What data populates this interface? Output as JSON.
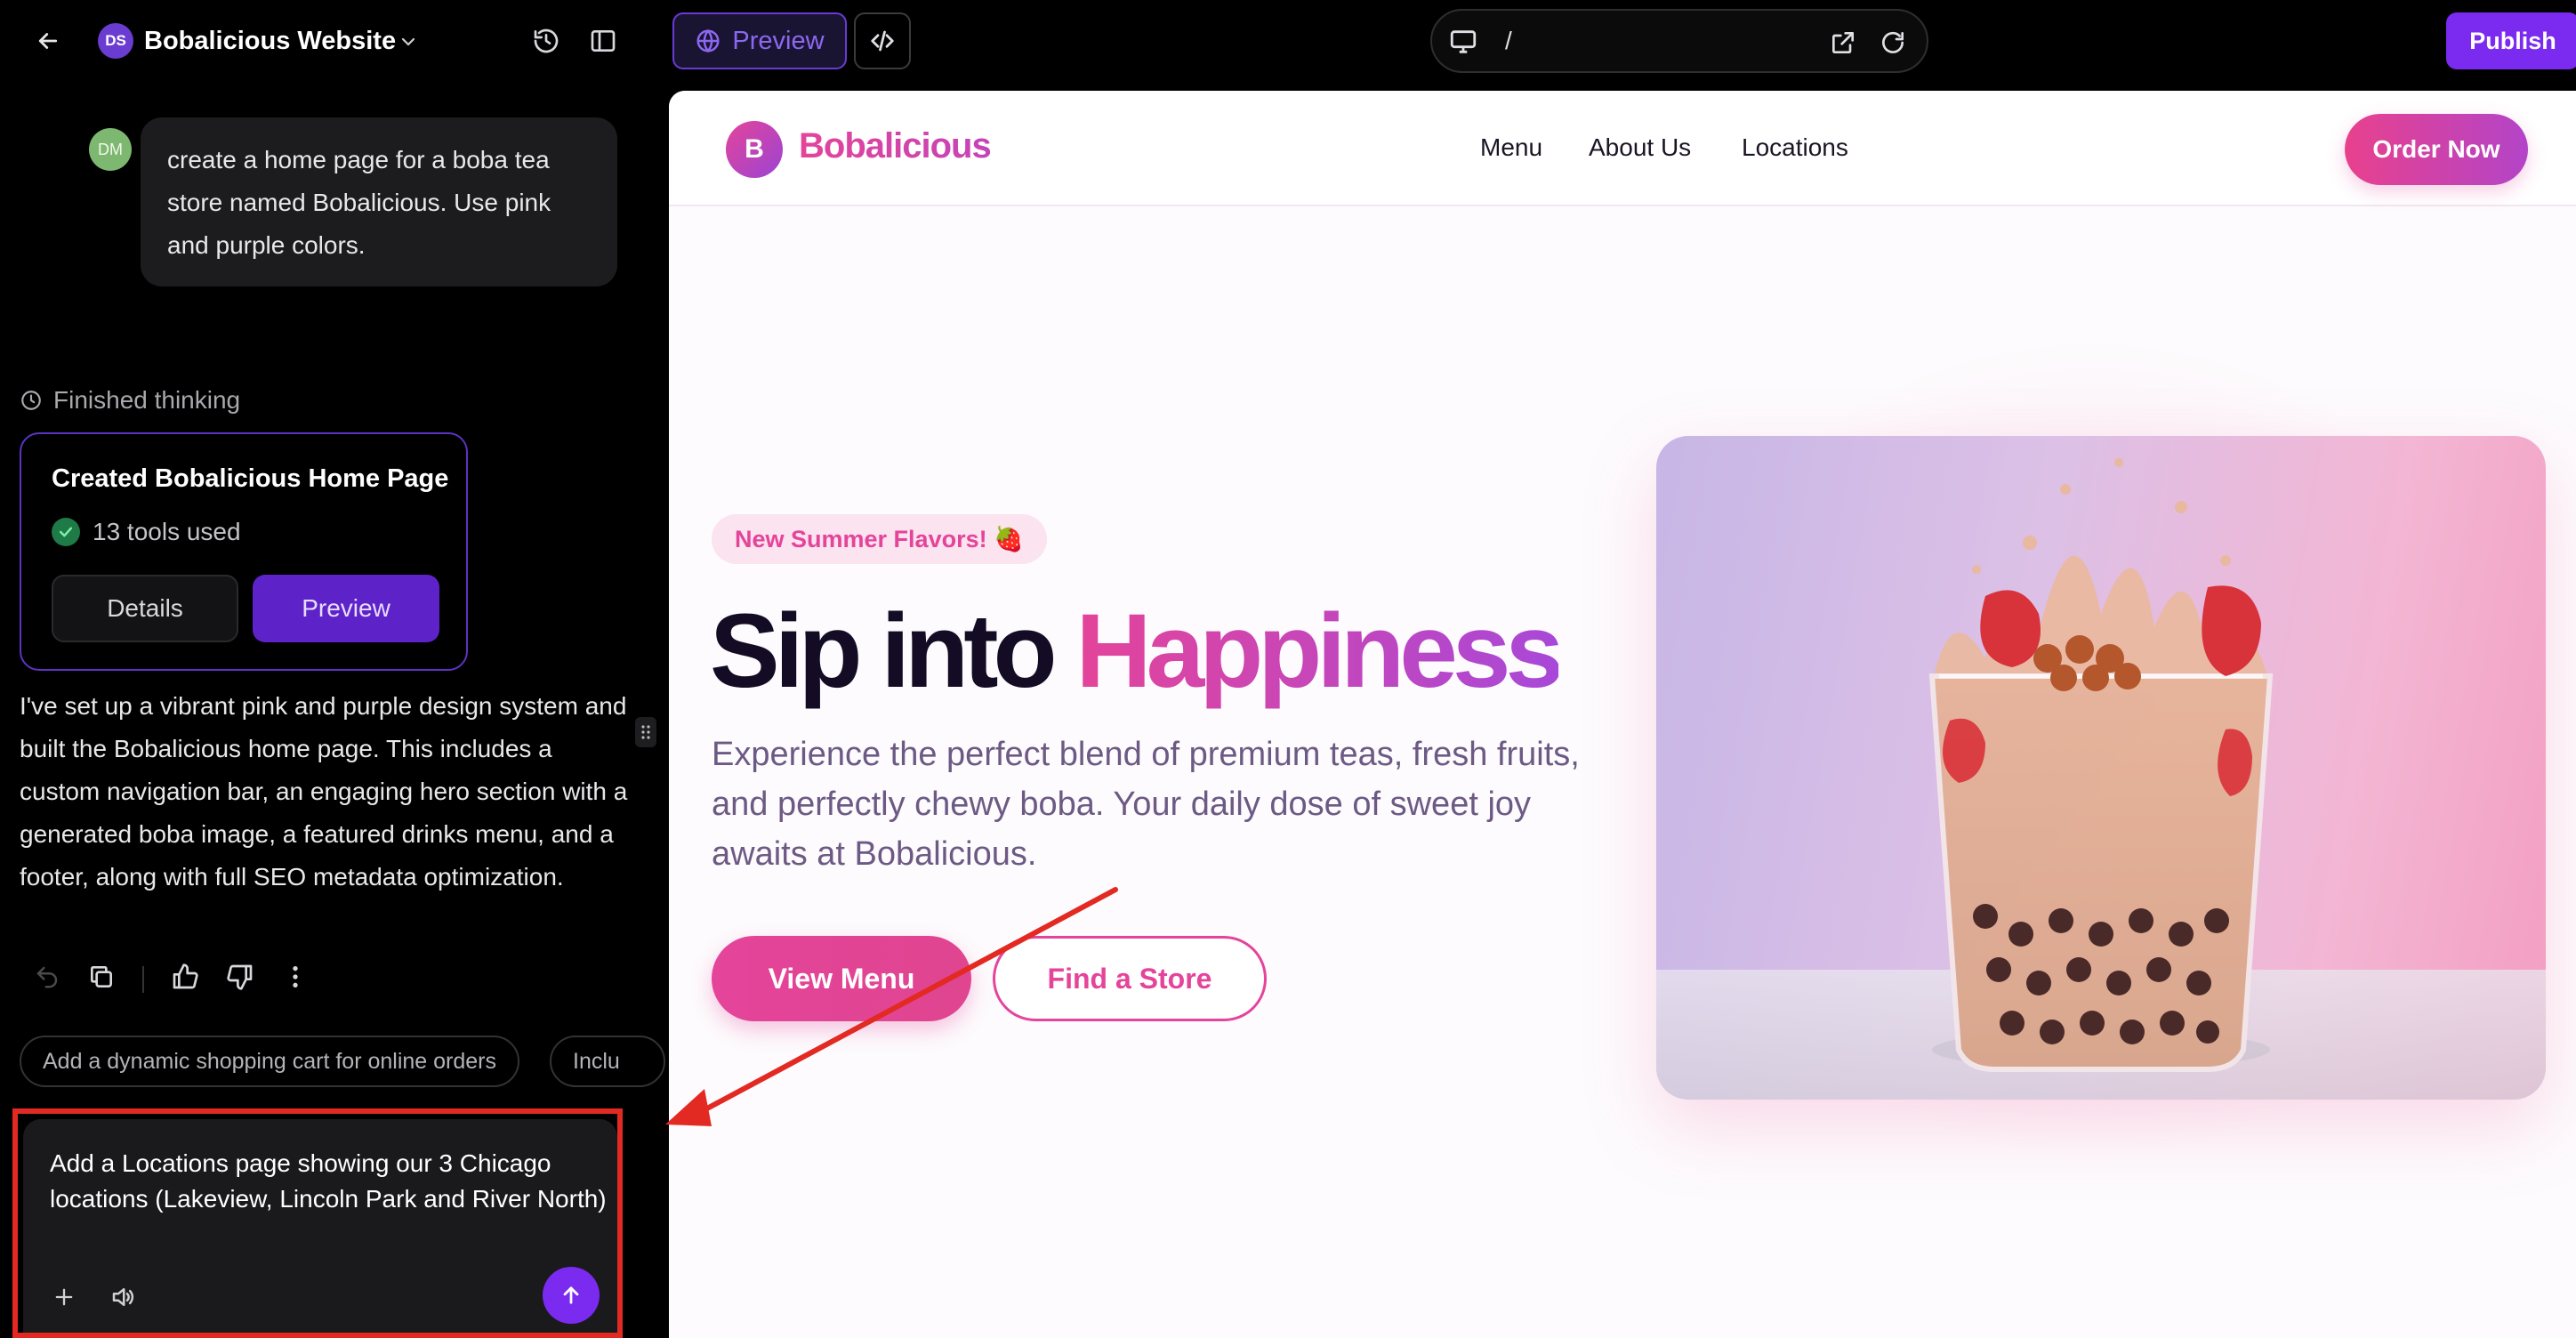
{
  "header": {
    "project_initials": "DS",
    "project_title": "Bobalicious Website"
  },
  "chat": {
    "user_initials": "DM",
    "user_message": "create a home page for a boba tea store named Bobalicious. Use pink and purple colors.",
    "thinking_status": "Finished thinking",
    "task_card": {
      "title": "Created Bobalicious Home Page",
      "tools_used": "13 tools used",
      "details_label": "Details",
      "preview_label": "Preview"
    },
    "assistant_message": "I've set up a vibrant pink and purple design system and built the Bobalicious home page. This includes a custom navigation bar, an engaging hero section with a generated boba image, a featured drinks menu, and a footer, along with full SEO metadata optimization.",
    "suggestions": [
      "Add a dynamic shopping cart for online orders",
      "Inclu"
    ],
    "input_text": "Add a Locations page showing our 3 Chicago locations (Lakeview, Lincoln Park and River North)"
  },
  "toolbar": {
    "preview_tab": "Preview",
    "url_path": "/",
    "publish_label": "Publish"
  },
  "site": {
    "logo_letter": "B",
    "brand": "Bobalicious",
    "nav_links": [
      "Menu",
      "About Us",
      "Locations"
    ],
    "order_button": "Order Now",
    "badge": "New Summer Flavors! 🍓",
    "hero_title_part1": "Sip into ",
    "hero_title_part2": "Happiness",
    "hero_subtitle": "Experience the perfect blend of premium teas, fresh fruits, and perfectly chewy boba. Your daily dose of sweet joy awaits at Bobalicious.",
    "primary_cta": "View Menu",
    "secondary_cta": "Find a Store"
  },
  "colors": {
    "accent_purple": "#7b2bf0",
    "brand_pink": "#e4449a",
    "highlight_red": "#e22a23"
  }
}
